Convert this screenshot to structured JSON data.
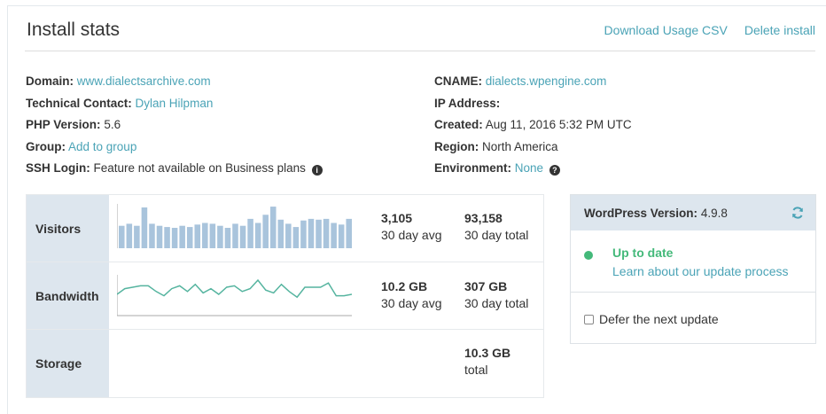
{
  "header": {
    "title": "Install stats",
    "download_csv": "Download Usage CSV",
    "delete_install": "Delete install"
  },
  "info_left": {
    "domain_label": "Domain:",
    "domain_value": "www.dialectsarchive.com",
    "contact_label": "Technical Contact:",
    "contact_value": "Dylan Hilpman",
    "php_label": "PHP Version:",
    "php_value": "5.6",
    "group_label": "Group:",
    "group_value": "Add to group",
    "ssh_label": "SSH Login:",
    "ssh_value": "Feature not available on Business plans",
    "ssh_info_icon": "info-circle-icon"
  },
  "info_right": {
    "cname_label": "CNAME:",
    "cname_value": "dialects.wpengine.com",
    "ip_label": "IP Address:",
    "created_label": "Created:",
    "created_value": "Aug 11, 2016 5:32 PM UTC",
    "region_label": "Region:",
    "region_value": "North America",
    "env_label": "Environment:",
    "env_value": "None",
    "env_help_icon": "question-circle-icon"
  },
  "stats": {
    "visitors": {
      "label": "Visitors",
      "avg_value": "3,105",
      "avg_label": "30 day avg",
      "total_value": "93,158",
      "total_label": "30 day total",
      "bars": [
        0.55,
        0.6,
        0.55,
        1.0,
        0.6,
        0.55,
        0.52,
        0.5,
        0.55,
        0.52,
        0.58,
        0.62,
        0.6,
        0.55,
        0.5,
        0.6,
        0.55,
        0.72,
        0.62,
        0.82,
        1.02,
        0.7,
        0.6,
        0.52,
        0.68,
        0.72,
        0.7,
        0.72,
        0.62,
        0.58,
        0.72
      ]
    },
    "bandwidth": {
      "label": "Bandwidth",
      "avg_value": "10.2 GB",
      "avg_label": "30 day avg",
      "total_value": "307 GB",
      "total_label": "30 day total",
      "line": [
        0.5,
        0.7,
        0.75,
        0.8,
        0.8,
        0.6,
        0.45,
        0.7,
        0.8,
        0.6,
        0.85,
        0.55,
        0.7,
        0.5,
        0.75,
        0.8,
        0.6,
        0.7,
        1.0,
        0.65,
        0.55,
        0.85,
        0.6,
        0.4,
        0.75,
        0.75,
        0.75,
        0.9,
        0.45,
        0.45,
        0.5
      ]
    },
    "storage": {
      "label": "Storage",
      "total_value": "10.3 GB",
      "total_label": "total"
    }
  },
  "wordpress": {
    "version_label": "WordPress Version:",
    "version_value": "4.9.8",
    "refresh_icon": "refresh-icon",
    "status": "Up to date",
    "learn_link": "Learn about our update process",
    "defer_label": "Defer the next update"
  },
  "colors": {
    "link": "#4aa3b6",
    "label_bg": "#dde6ee",
    "chart": "#a9c4dc",
    "line": "#55b49f",
    "success": "#44b97a"
  }
}
